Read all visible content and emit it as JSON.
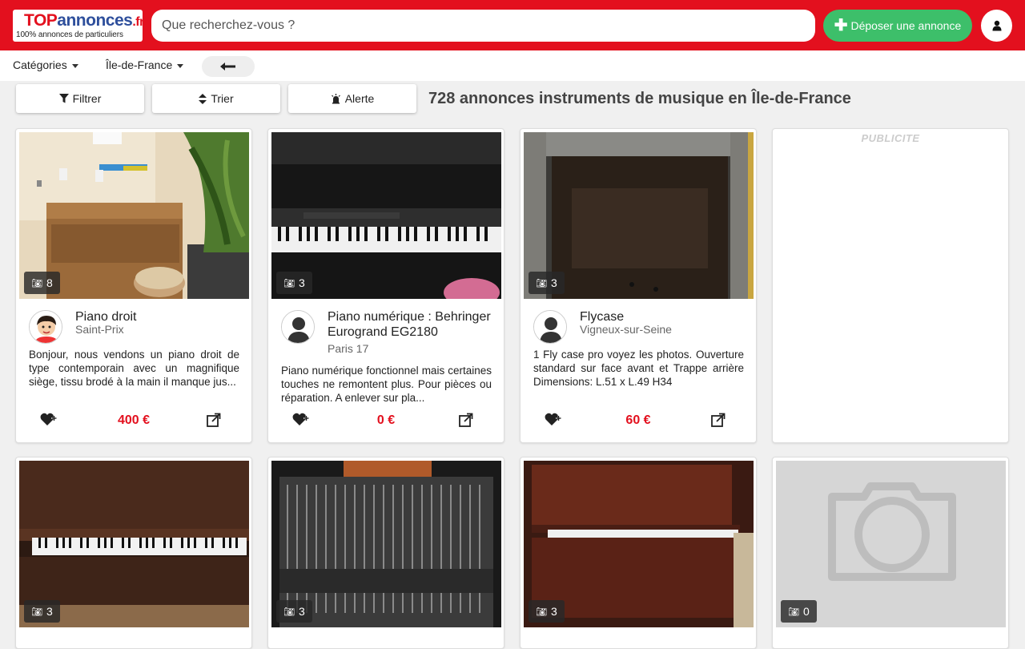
{
  "header": {
    "logo_top": "TOP",
    "logo_annonces": "annonces",
    "logo_tld": ".fr",
    "logo_tagline": "100% annonces de particuliers",
    "search_placeholder": "Que recherchez-vous ?",
    "post_label": "Déposer une annonce",
    "colors": {
      "brand_red": "#e3101e",
      "post_green": "#3dbf6a",
      "logo_blue": "#2e4f9c"
    }
  },
  "subnav": {
    "categories_label": "Catégories",
    "region_label": "Île-de-France",
    "back_icon": "arrow-left-icon"
  },
  "toolbar": {
    "filter_label": "Filtrer",
    "sort_label": "Trier",
    "alert_label": "Alerte",
    "results_title": "728 annonces instruments de musique en Île-de-France"
  },
  "listings": [
    {
      "title": "Piano droit",
      "location": "Saint-Prix",
      "description": "Bonjour, nous vendons un piano droit de type contemporain avec un magnifique siège, tissu brodé à la main il manque jus...",
      "price": "400 €",
      "photo_count": "8",
      "avatar": "cartoon-avatar"
    },
    {
      "title": "Piano numérique : Behringer Eurogrand EG2180",
      "location": "Paris 17",
      "description": "Piano numérique fonctionnel mais certaines touches ne remontent plus. Pour pièces ou réparation. A enlever sur pla...",
      "price": "0 €",
      "photo_count": "3",
      "avatar": "default-avatar"
    },
    {
      "title": "Flycase",
      "location": "Vigneux-sur-Seine",
      "description": "1 Fly case pro voyez les photos. Ouverture standard sur face avant et Trappe arrière Dimensions: L.51 x L.49 H34",
      "price": "60 €",
      "photo_count": "3",
      "avatar": "default-avatar"
    },
    {
      "photo_count": "3"
    },
    {
      "photo_count": "3"
    },
    {
      "photo_count": "3"
    },
    {
      "photo_count": "0"
    }
  ],
  "ad": {
    "label": "PUBLICITE"
  }
}
